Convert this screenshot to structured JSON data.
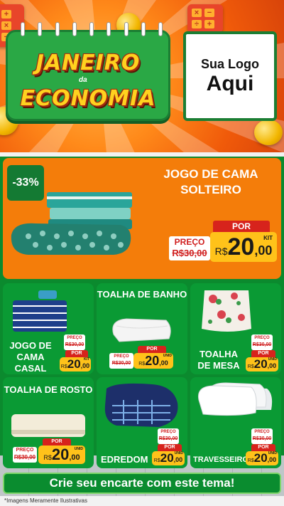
{
  "header": {
    "title_line1": "JANEIRO",
    "title_connector": "da",
    "title_line2": "ECONOMIA",
    "logo_line1": "Sua Logo",
    "logo_line2": "Aqui"
  },
  "featured": {
    "discount": "-33%",
    "title": "JOGO DE CAMA SOLTEIRO",
    "preco_label": "PREÇO",
    "old_price": "R$30,00",
    "por_label": "POR",
    "currency": "R$",
    "price_int": "20",
    "price_dec": ",00",
    "unit": "KIT"
  },
  "products": [
    {
      "name": "JOGO DE CAMA CASAL",
      "preco_label": "PREÇO",
      "old_price": "R$30,00",
      "por_label": "POR",
      "currency": "R$",
      "price_int": "20",
      "price_dec": ",00",
      "unit": "KIT"
    },
    {
      "name": "TOALHA DE BANHO",
      "preco_label": "PREÇO",
      "old_price": "R$30,00",
      "por_label": "POR",
      "currency": "R$",
      "price_int": "20",
      "price_dec": ",00",
      "unit": "UNID"
    },
    {
      "name": "TOALHA DE MESA",
      "preco_label": "PREÇO",
      "old_price": "R$30,00",
      "por_label": "POR",
      "currency": "R$",
      "price_int": "20",
      "price_dec": ",00",
      "unit": "UNID"
    },
    {
      "name": "TOALHA DE ROSTO",
      "preco_label": "PREÇO",
      "old_price": "R$30,00",
      "por_label": "POR",
      "currency": "R$",
      "price_int": "20",
      "price_dec": ",00",
      "unit": "UNID"
    },
    {
      "name": "EDREDOM",
      "preco_label": "PREÇO",
      "old_price": "R$30,00",
      "por_label": "POR",
      "currency": "R$",
      "price_int": "20",
      "price_dec": ",00",
      "unit": "UNID"
    },
    {
      "name": "TRAVESSEIRO",
      "preco_label": "PREÇO",
      "old_price": "R$30,00",
      "por_label": "POR",
      "currency": "R$",
      "price_int": "20",
      "price_dec": ",00",
      "unit": "UNID"
    }
  ],
  "cta": "Crie seu encarte com este tema!",
  "disclaimer": "*Imagens Meramente Ilustrativas",
  "colors": {
    "orange": "#f47d0a",
    "green": "#0a9a34",
    "yellow": "#ffc21a",
    "red": "#d7231c"
  }
}
